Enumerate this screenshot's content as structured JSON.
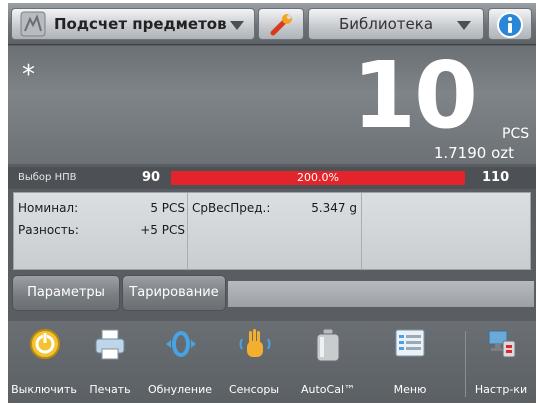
{
  "header": {
    "app_label": "Подсчет предметов",
    "library_label": "Библиотека"
  },
  "display": {
    "stable_mark": "*",
    "value": "10",
    "unit": "PCS",
    "secondary": "1.7190 ozt"
  },
  "accept": {
    "label": "Выбор НПВ",
    "low": "90",
    "percent_text": "200.0%",
    "percent_value": 200.0,
    "high": "110",
    "bar_color": "#e3242b"
  },
  "info": {
    "nominal_label": "Номинал:",
    "nominal_value": "5 PCS",
    "diff_label": "Разность:",
    "diff_value": "+5 PCS",
    "apw_label": "СрВесПред.:",
    "apw_value": "5.347 g"
  },
  "softkeys": {
    "params": "Параметры",
    "tare": "Тарирование"
  },
  "toolbar": {
    "items": [
      {
        "label": "Выключить",
        "icon": "power-icon"
      },
      {
        "label": "Печать",
        "icon": "printer-icon"
      },
      {
        "label": "Обнуление",
        "icon": "zero-icon"
      },
      {
        "label": "Сенсоры",
        "icon": "hand-sensor-icon"
      },
      {
        "label": "AutoCal™",
        "icon": "calibration-weight-icon"
      },
      {
        "label": "Меню",
        "icon": "menu-icon"
      },
      {
        "label": "Настр-ки",
        "icon": "setup-icon"
      }
    ]
  }
}
